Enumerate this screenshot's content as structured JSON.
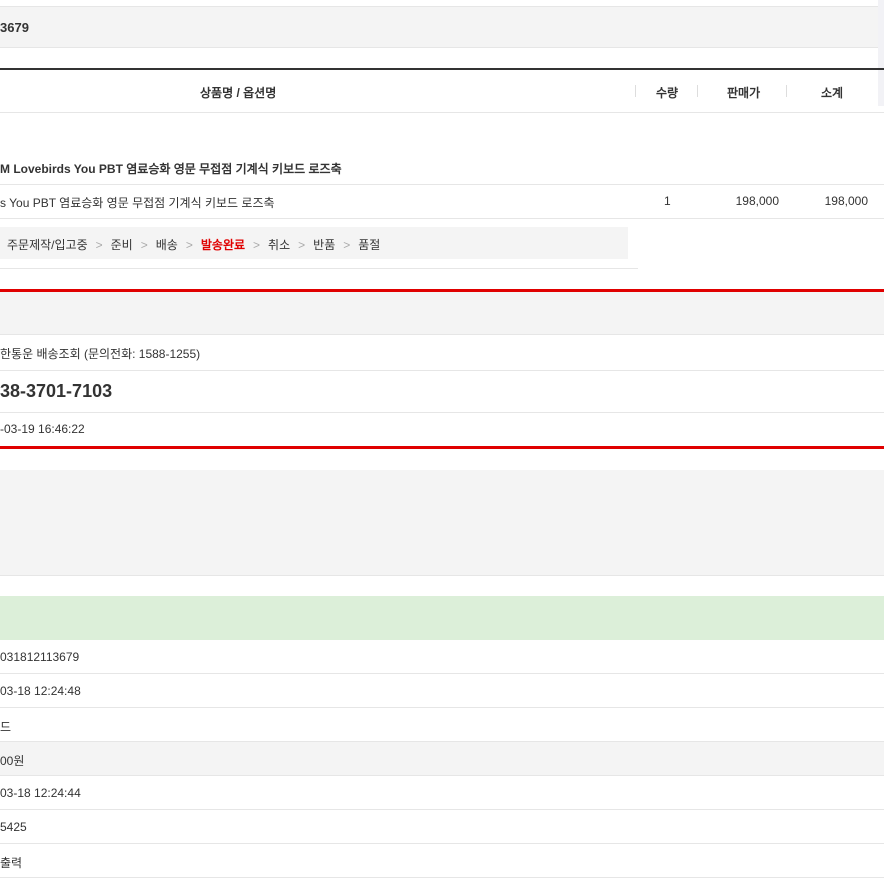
{
  "order_header": {
    "order_number": "3679"
  },
  "product_table": {
    "columns": {
      "name": "상품명 / 옵션명",
      "qty": "수량",
      "price": "판매가",
      "subtotal": "소계"
    },
    "product_title": "M Lovebirds You PBT 염료승화 영문 무접점 기계식 키보드 로즈축",
    "option_name": "s You PBT 염료승화 영문 무접점 기계식 키보드 로즈축",
    "qty": "1",
    "price": "198,000",
    "subtotal": "198,000"
  },
  "status_steps": [
    {
      "label": "주문제작/입고중",
      "active": false
    },
    {
      "label": "준비",
      "active": false
    },
    {
      "label": "배송",
      "active": false
    },
    {
      "label": "발송완료",
      "active": true
    },
    {
      "label": "취소",
      "active": false
    },
    {
      "label": "반품",
      "active": false
    },
    {
      "label": "품절",
      "active": false
    }
  ],
  "shipping": {
    "carrier_text": "한통운 배송조회 (문의전화: 1588-1255)",
    "tracking_number": "38-3701-7103",
    "shipped_at": "-03-19 16:46:22"
  },
  "order_info": {
    "rows": [
      {
        "value": "031812113679"
      },
      {
        "value": "03-18 12:24:48"
      },
      {
        "value": "드"
      },
      {
        "value": "00원"
      },
      {
        "value": "03-18 12:24:44"
      },
      {
        "value": "5425"
      },
      {
        "value": "출력"
      }
    ]
  },
  "colors": {
    "accent_red": "#e00000",
    "success_green_bg": "#dcefd9",
    "section_gray": "#f4f4f4"
  }
}
